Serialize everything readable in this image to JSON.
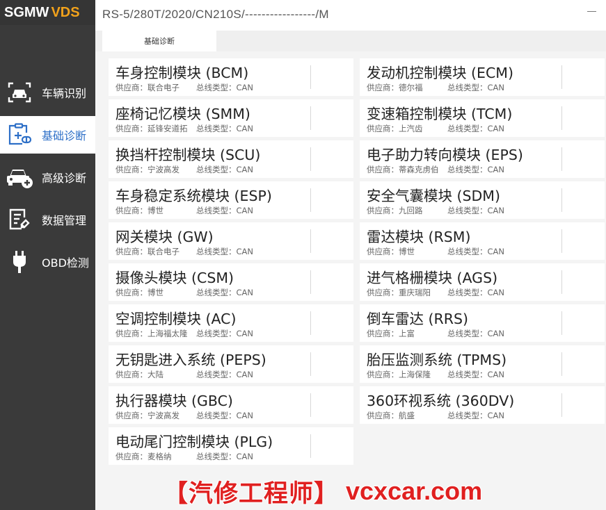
{
  "app": {
    "brand_left": "SGMW",
    "brand_right": "VDS"
  },
  "topbar": {
    "vin_path": "RS-5/280T/2020/CN210S/-----------------/M"
  },
  "tabs": [
    {
      "label": "基础诊断",
      "active": true
    }
  ],
  "sidebar": {
    "items": [
      {
        "label": "车辆识别",
        "icon": "car-scan-icon",
        "active": false
      },
      {
        "label": "基础诊断",
        "icon": "diagnosis-clipboard-icon",
        "active": true
      },
      {
        "label": "高级诊断",
        "icon": "car-plus-icon",
        "active": false
      },
      {
        "label": "数据管理",
        "icon": "document-edit-icon",
        "active": false
      },
      {
        "label": "OBD检测",
        "icon": "plug-icon",
        "active": false
      }
    ]
  },
  "supplier_prefix": "供应商：",
  "bus_prefix": "总线类型：",
  "modules": [
    {
      "name": "车身控制模块 (BCM)",
      "supplier": "联合电子",
      "bus": "CAN"
    },
    {
      "name": "发动机控制模块 (ECM)",
      "supplier": "德尔福",
      "bus": "CAN"
    },
    {
      "name": "座椅记忆模块 (SMM)",
      "supplier": "延锋安道拓",
      "bus": "CAN"
    },
    {
      "name": "变速箱控制模块 (TCM)",
      "supplier": "上汽齿",
      "bus": "CAN"
    },
    {
      "name": "换挡杆控制模块 (SCU)",
      "supplier": "宁波高发",
      "bus": "CAN"
    },
    {
      "name": "电子助力转向模块 (EPS)",
      "supplier": "蒂森克虏伯",
      "bus": "CAN"
    },
    {
      "name": "车身稳定系统模块 (ESP)",
      "supplier": "博世",
      "bus": "CAN"
    },
    {
      "name": "安全气囊模块 (SDM)",
      "supplier": "九回路",
      "bus": "CAN"
    },
    {
      "name": "网关模块 (GW)",
      "supplier": "联合电子",
      "bus": "CAN"
    },
    {
      "name": "雷达模块 (RSM)",
      "supplier": "博世",
      "bus": "CAN"
    },
    {
      "name": "摄像头模块 (CSM)",
      "supplier": "博世",
      "bus": "CAN"
    },
    {
      "name": "进气格栅模块 (AGS)",
      "supplier": "重庆瑞阳",
      "bus": "CAN"
    },
    {
      "name": "空调控制模块 (AC)",
      "supplier": "上海福太隆",
      "bus": "CAN"
    },
    {
      "name": "倒车雷达 (RRS)",
      "supplier": "上富",
      "bus": "CAN"
    },
    {
      "name": "无钥匙进入系统 (PEPS)",
      "supplier": "大陆",
      "bus": "CAN"
    },
    {
      "name": "胎压监测系统 (TPMS)",
      "supplier": "上海保隆",
      "bus": "CAN"
    },
    {
      "name": "执行器模块 (GBC)",
      "supplier": "宁波高发",
      "bus": "CAN"
    },
    {
      "name": "360环视系统 (360DV)",
      "supplier": "航盛",
      "bus": "CAN"
    },
    {
      "name": "电动尾门控制模块 (PLG)",
      "supplier": "麦格纳",
      "bus": "CAN"
    }
  ],
  "watermark": {
    "cn": "【汽修工程师】",
    "url": "vcxcar.com"
  },
  "colors": {
    "sidebar_bg": "#3a3a3a",
    "accent_blue": "#2d6fc7",
    "brand_orange": "#f2a21b",
    "watermark_red": "#e02020"
  }
}
